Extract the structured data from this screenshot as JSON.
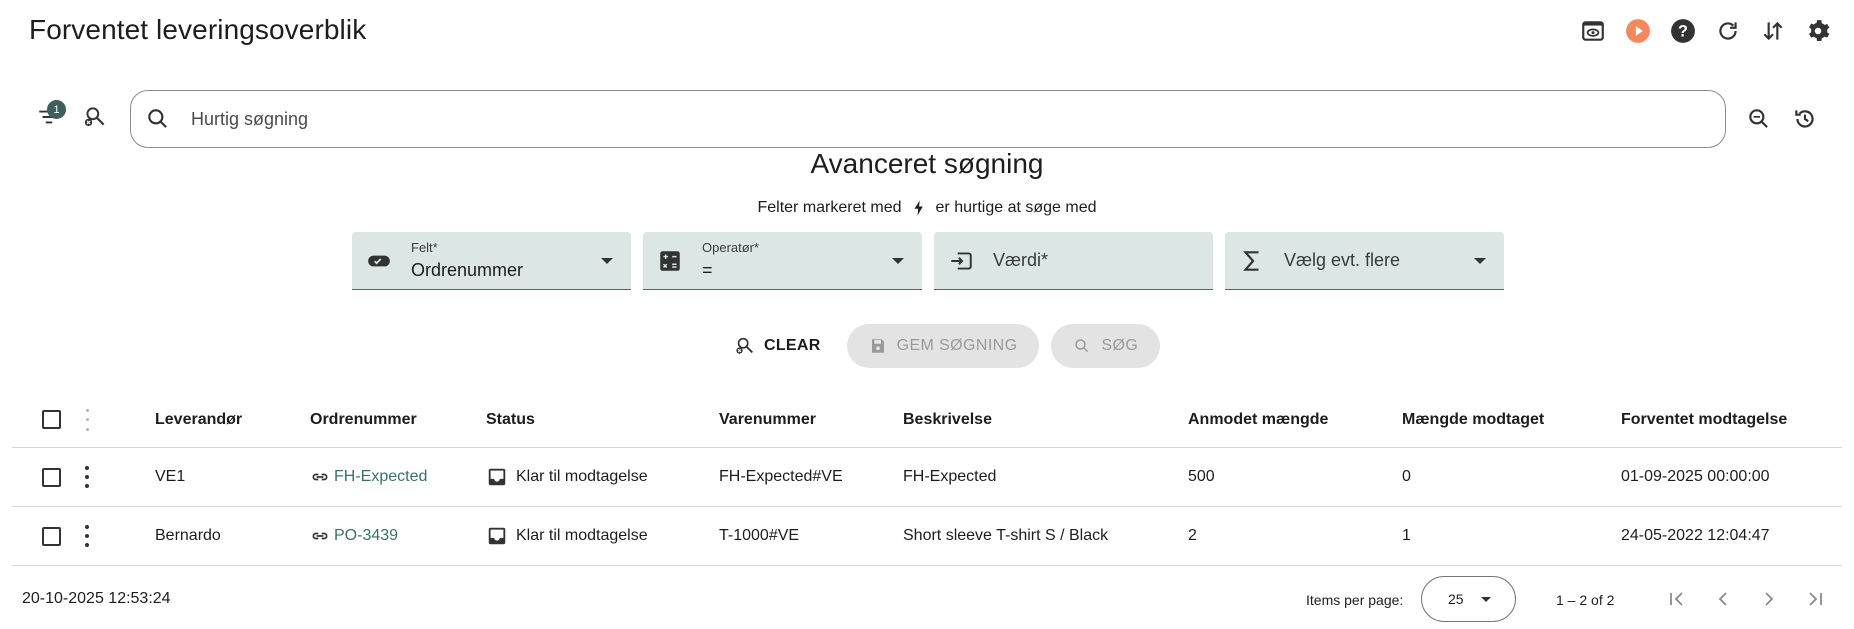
{
  "header": {
    "title": "Forventet leveringsoverblik",
    "icons": [
      "preview-icon",
      "play-icon",
      "help-icon",
      "refresh-icon",
      "sort-icon",
      "settings-icon"
    ],
    "play_color": "#f4875e"
  },
  "search": {
    "filter_count": "1",
    "placeholder": "Hurtig søgning"
  },
  "advanced": {
    "title": "Avanceret søgning",
    "hint_before": "Felter markeret med",
    "hint_after": "er hurtige at søge med",
    "fields": [
      {
        "label": "Felt*",
        "value": "Ordrenummer",
        "icon": "toggle-icon"
      },
      {
        "label": "Operatør*",
        "value": "=",
        "icon": "calculator-icon"
      },
      {
        "placeholder": "Værdi*",
        "icon": "input-icon"
      },
      {
        "placeholder": "Vælg evt. flere",
        "icon": "sigma-icon"
      }
    ],
    "buttons": {
      "clear": "CLEAR",
      "save": "GEM SØGNING",
      "search": "SØG"
    }
  },
  "table": {
    "columns": [
      "Leverandør",
      "Ordrenummer",
      "Status",
      "Varenummer",
      "Beskrivelse",
      "Anmodet mængde",
      "Mængde modtaget",
      "Forventet modtagelse"
    ],
    "rows": [
      {
        "supplier": "VE1",
        "order": "FH-Expected",
        "status": "Klar til modtagelse",
        "item": "FH-Expected#VE",
        "description": "FH-Expected",
        "requested": "500",
        "received": "0",
        "expected": "01-09-2025 00:00:00"
      },
      {
        "supplier": "Bernardo",
        "order": "PO-3439",
        "status": "Klar til modtagelse",
        "item": "T-1000#VE",
        "description": "Short sleeve T-shirt S / Black",
        "requested": "2",
        "received": "1",
        "expected": "24-05-2022 12:04:47"
      }
    ]
  },
  "footer": {
    "timestamp": "20-10-2025 12:53:24",
    "items_per_page_label": "Items per page:",
    "items_per_page": "25",
    "range": "1 – 2 of 2"
  },
  "colors": {
    "accent": "#3d5f5e",
    "link": "#3d6f6a",
    "field_bg": "#dce6e5"
  }
}
